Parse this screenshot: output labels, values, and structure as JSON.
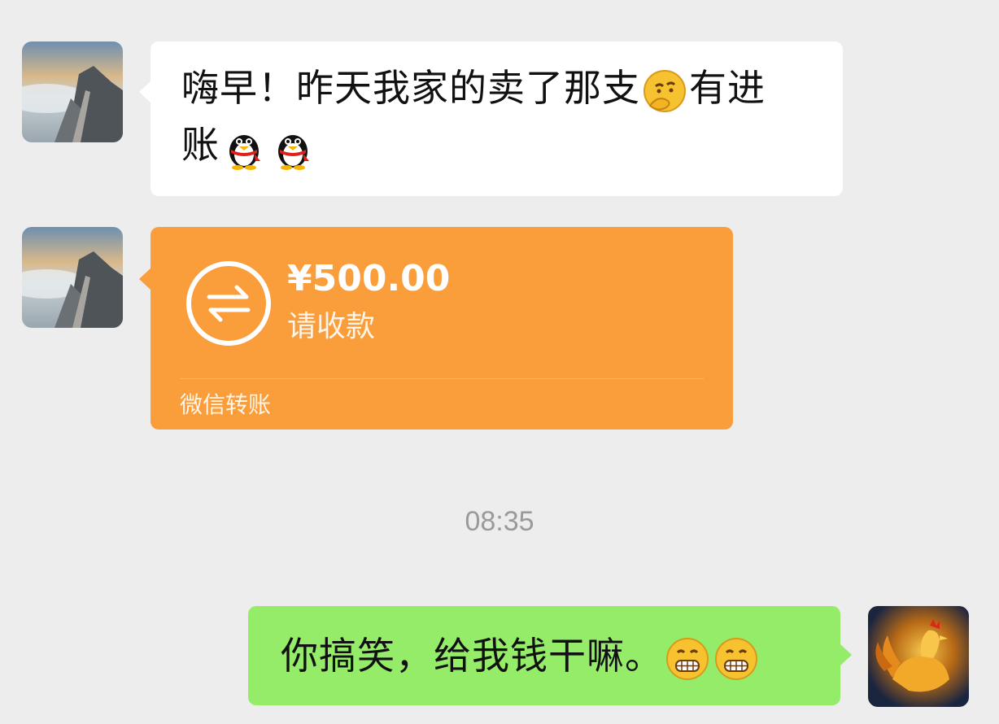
{
  "messages": {
    "first": {
      "line1": "嗨早！昨天我家的卖了那支",
      "line1_suffix": "有进",
      "line2": "账",
      "emojis": [
        "thinking-emoji",
        "penguin-emoji",
        "penguin-emoji"
      ]
    },
    "transfer": {
      "amount": "¥500.00",
      "status": "请收款",
      "footer": "微信转账",
      "icon": "transfer-arrows-icon"
    },
    "timestamp": "08:35",
    "reply": {
      "text": "你搞笑，给我钱干嘛。",
      "emojis": [
        "grin-emoji",
        "grin-emoji"
      ]
    }
  },
  "colors": {
    "background": "#ededed",
    "incoming_bubble": "#ffffff",
    "transfer_bubble": "#fa9d3b",
    "outgoing_bubble": "#95ec69"
  },
  "avatars": {
    "contact": "mountain-landscape-avatar",
    "self": "golden-rooster-avatar"
  }
}
